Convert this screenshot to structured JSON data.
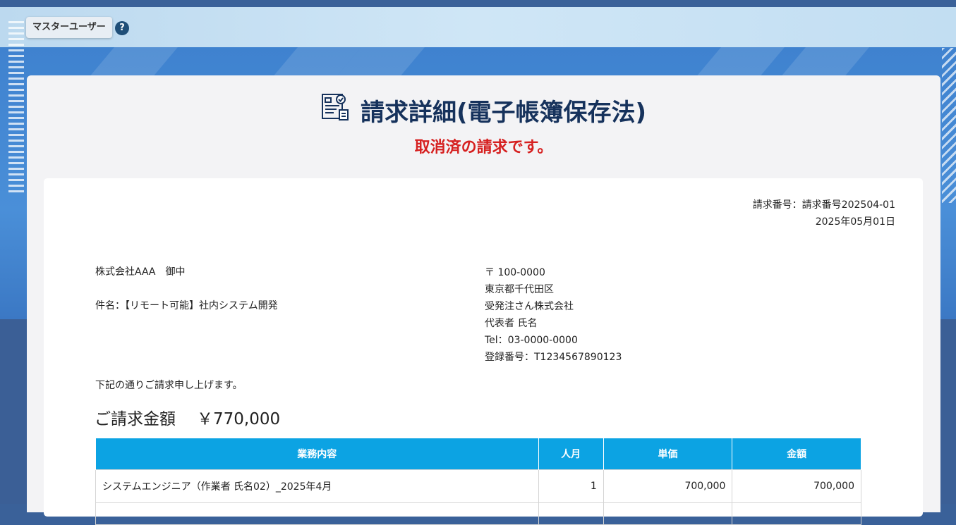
{
  "header": {
    "user_label": "マスターユーザー",
    "help_icon": "?"
  },
  "page": {
    "title": "請求詳細(電子帳簿保存法)",
    "cancel_message": "取消済の請求です。"
  },
  "invoice": {
    "number_line": "請求番号：請求番号202504-01",
    "date": "2025年05月01日",
    "client": "株式会社AAA　御中",
    "subject": "件名：【リモート可能】社内システム開発",
    "issuer": {
      "postal": "〒 100-0000",
      "address": "東京都千代田区",
      "company": "受発注さん株式会社",
      "representative": "代表者 氏名",
      "tel": "Tel：03-0000-0000",
      "registration": "登録番号：T1234567890123"
    },
    "intro": "下記の通りご請求申し上げます。",
    "total_label": "ご請求金額",
    "total_amount": "￥770,000"
  },
  "table": {
    "headers": [
      "業務内容",
      "人月",
      "単価",
      "金額"
    ],
    "rows": [
      {
        "item": "システムエンジニア（作業者 氏名02）_2025年4月",
        "qty": "1",
        "unit_price": "700,000",
        "amount": "700,000"
      }
    ]
  },
  "colors": {
    "title": "#16325c",
    "cancel": "#d62020",
    "table_header": "#0ca3e3"
  }
}
